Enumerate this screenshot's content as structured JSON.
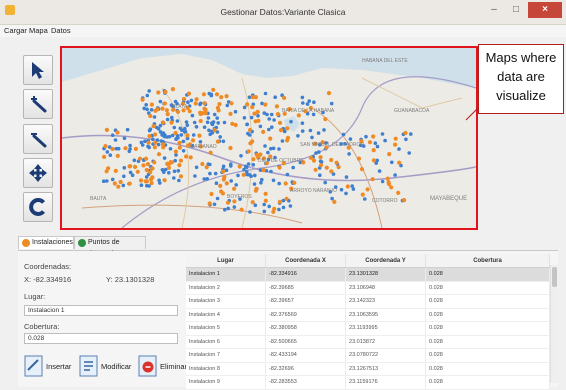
{
  "window": {
    "title": "Gestionar Datos:Variante Clasica",
    "min_glyph": "–",
    "max_glyph": "□",
    "close_glyph": "×"
  },
  "menu": {
    "items": [
      "Cargar Mapa",
      "Datos"
    ]
  },
  "toolbar": {
    "tools": [
      "select-arrow",
      "zoom-in",
      "zoom-out",
      "pan",
      "refresh"
    ]
  },
  "map": {
    "place_labels": [
      "BAHIA DE LA HABANA",
      "GUANABACOA",
      "HABANA DEL ESTE",
      "SAN MIGUEL DEL PADRON",
      "DIEZ DE OCTUBRE",
      "ARROYO NARANJO",
      "BAUTA",
      "BOYEROS",
      "COTORRO",
      "MAYABEQUE",
      "PLAYA",
      "MARIANAO"
    ],
    "colors": {
      "instalacion": "#f08a24",
      "demanda": "#3f7fcf"
    }
  },
  "callout": {
    "lines": [
      "Maps where",
      "data are",
      "visualize"
    ]
  },
  "tabs": [
    {
      "label": "Instalaciones",
      "color": "#f08a24"
    },
    {
      "label": "Puntos de demandas",
      "color": "#2f8f43"
    }
  ],
  "form": {
    "coords_label": "Coordenadas:",
    "x_text": "X:  -82.334916",
    "y_text": "Y:  23.1301328",
    "lugar_label": "Lugar:",
    "lugar_value": "Instalacion 1",
    "cobertura_label": "Cobertura:",
    "cobertura_value": "0.028"
  },
  "actions": {
    "insert": "Insertar",
    "modify": "Modificar",
    "delete": "Eliminar"
  },
  "table": {
    "headers": [
      "Lugar",
      "Coordenada X",
      "Coordenada Y",
      "Cobertura"
    ],
    "rows": [
      [
        "Instalacion 1",
        "-82.334916",
        "23.1301328",
        "0.028"
      ],
      [
        "Instalacion 2",
        "-82.39685",
        "23.106948",
        "0.028"
      ],
      [
        "Instalacion 3",
        "-82.39657",
        "23.142323",
        "0.028"
      ],
      [
        "Instalacion 4",
        "-82.376569",
        "23.1063595",
        "0.028"
      ],
      [
        "Instalacion 5",
        "-82.380958",
        "23.1193995",
        "0.028"
      ],
      [
        "Instalacion 6",
        "-82.500665",
        "23.013872",
        "0.028"
      ],
      [
        "Instalacion 7",
        "-82.433194",
        "23.0780722",
        "0.028"
      ],
      [
        "Instalacion 8",
        "-82.32696",
        "23.1267513",
        "0.028"
      ],
      [
        "Instalacion 9",
        "-82.283553",
        "23.1159176",
        "0.028"
      ]
    ]
  }
}
